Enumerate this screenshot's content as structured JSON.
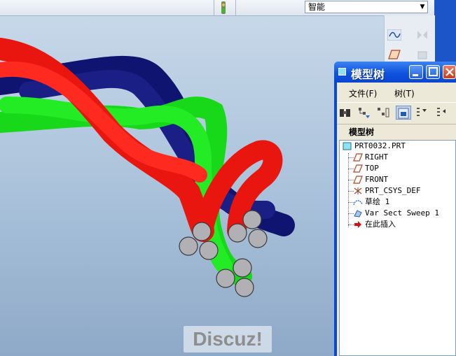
{
  "toolbar": {
    "filter_value": "智能"
  },
  "model_tree": {
    "title": "模型树",
    "menu": [
      "文件(F)",
      "树(T)"
    ],
    "panel_label": "模型树",
    "root": "PRT0032.PRT",
    "items": [
      {
        "label": "RIGHT",
        "icon": "datum-plane-icon"
      },
      {
        "label": "TOP",
        "icon": "datum-plane-icon"
      },
      {
        "label": "FRONT",
        "icon": "datum-plane-icon"
      },
      {
        "label": "PRT_CSYS_DEF",
        "icon": "csys-icon"
      },
      {
        "label": "草绘 1",
        "icon": "sketch-icon"
      },
      {
        "label": "Var Sect Sweep 1",
        "icon": "sweep-icon"
      },
      {
        "label": "在此插入",
        "icon": "insert-here-arrow-icon"
      }
    ]
  },
  "watermark": "Discuz!",
  "colors": {
    "rope_red": "#e8160f",
    "rope_green": "#17e81a",
    "rope_blue": "#0e1470",
    "cap_gray": "#b0b0b5"
  }
}
